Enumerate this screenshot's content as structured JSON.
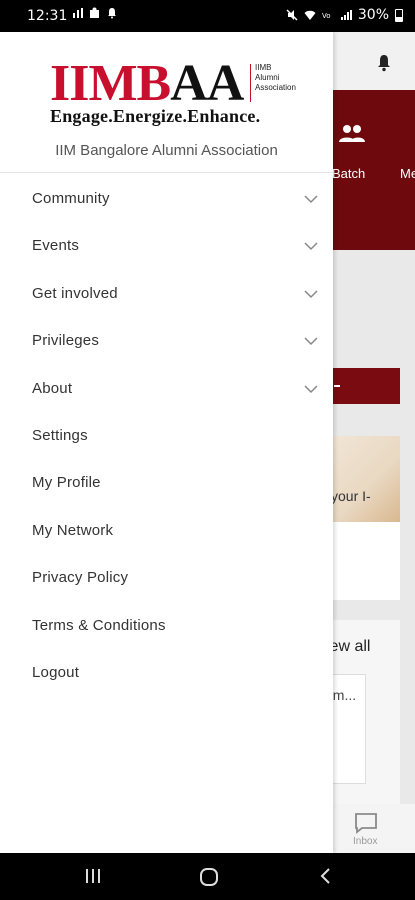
{
  "status_bar": {
    "time": "12:31",
    "battery": "30%",
    "icons_left": [
      "chart-icon",
      "puzzle-icon",
      "notification-bell-icon"
    ],
    "icons_right": [
      "mute-icon",
      "wifi-icon",
      "volte-icon",
      "signal-icon",
      "battery-icon"
    ]
  },
  "drawer": {
    "logo": {
      "mark_red": "IIMB",
      "mark_black": "AA",
      "sub_lines": "IIMB\nAlumni\nAssociation",
      "tagline": "Engage.Energize.Enhance."
    },
    "org_name": "IIM Bangalore Alumni Association",
    "menu": [
      {
        "label": "Community",
        "expandable": true
      },
      {
        "label": "Events",
        "expandable": true
      },
      {
        "label": "Get involved",
        "expandable": true
      },
      {
        "label": "Privileges",
        "expandable": true
      },
      {
        "label": "About",
        "expandable": true
      },
      {
        "label": "Settings",
        "expandable": false
      },
      {
        "label": "My Profile",
        "expandable": false
      },
      {
        "label": "My Network",
        "expandable": false
      },
      {
        "label": "Privacy Policy",
        "expandable": false
      },
      {
        "label": "Terms & Conditions",
        "expandable": false
      },
      {
        "label": "Logout",
        "expandable": false
      }
    ]
  },
  "background_app": {
    "hero_labels": {
      "batch": "Batch",
      "more": "Me"
    },
    "card_text": "your I-",
    "view_all": "iew all",
    "card2_text": "nm...",
    "bottom_tab": {
      "inbox_label": "Inbox"
    }
  },
  "colors": {
    "brand_red": "#c8102e",
    "maroon": "#6e0a0e"
  }
}
